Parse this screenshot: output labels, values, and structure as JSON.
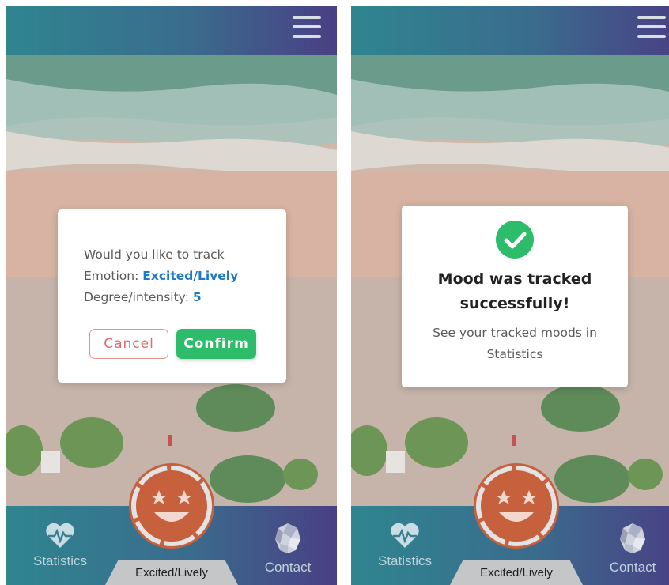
{
  "screens": [
    {
      "id": "left",
      "dialog": {
        "line1": "Would you like to track",
        "emotion_label": "Emotion:",
        "emotion_value": "Excited/Lively",
        "degree_label": "Degree/intensity:",
        "degree_value": "5",
        "cancel_label": "Cancel",
        "confirm_label": "Confirm"
      },
      "nav": {
        "statistics_label": "Statistics",
        "contact_label": "Contact",
        "current_mood": "Excited/Lively"
      }
    },
    {
      "id": "right",
      "dialog": {
        "title_line1": "Mood was tracked",
        "title_line2": "successfully!",
        "sub_line1": "See your tracked moods in",
        "sub_line2": "Statistics"
      },
      "nav": {
        "statistics_label": "Statistics",
        "contact_label": "Contact",
        "current_mood": "Excited/Lively"
      }
    }
  ],
  "icons": {
    "menu": "hamburger-icon",
    "statistics": "heart-pulse-icon",
    "contact": "contact-icon",
    "success": "check-circle-icon",
    "mood": "star-eyes-face-icon"
  },
  "colors": {
    "header_gradient_start": "#2f8590",
    "header_gradient_end": "#4a3f84",
    "accent_blue": "#1f78c2",
    "confirm_green": "#2dbd6a",
    "cancel_red": "#e06c6a",
    "mood_orange": "#c5603d"
  }
}
